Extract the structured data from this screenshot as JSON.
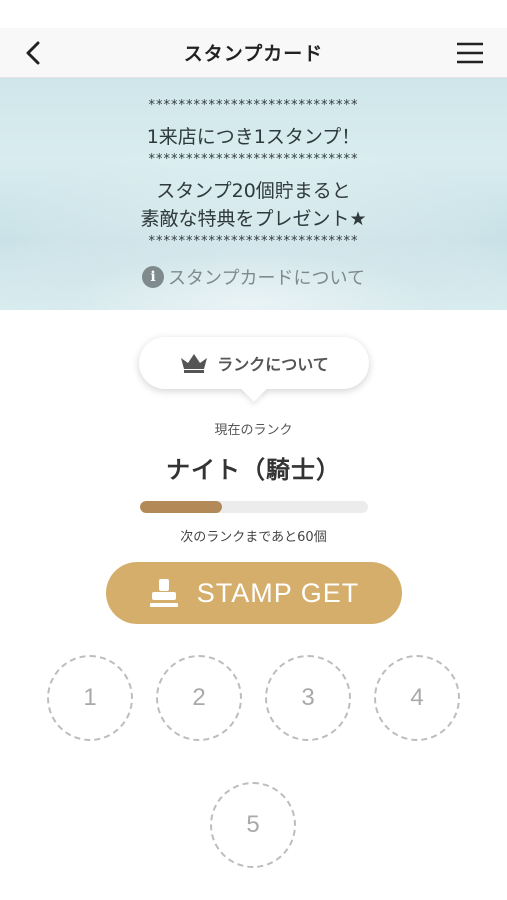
{
  "header": {
    "title": "スタンプカード",
    "back_icon": "chevron-left-icon",
    "menu_icon": "hamburger-menu-icon"
  },
  "banner": {
    "stars": "****************************",
    "line1": "1来店につき1スタンプ！",
    "line2": "スタンプ20個貯まると",
    "line3": "素敵な特典をプレゼント★",
    "about_label": "スタンプカードについて",
    "info_glyph": "i"
  },
  "rank": {
    "bubble_label": "ランクについて",
    "current_label": "現在のランク",
    "name": "ナイト（騎士）",
    "progress_fraction": 0.36,
    "progress_color": "#b38a57",
    "next_text": "次のランクまであと60個"
  },
  "stamp_button": {
    "label": "STAMP GET",
    "color": "#d4ae6a"
  },
  "stamps": [
    {
      "number": "1"
    },
    {
      "number": "2"
    },
    {
      "number": "3"
    },
    {
      "number": "4"
    },
    {
      "number": "5"
    }
  ]
}
